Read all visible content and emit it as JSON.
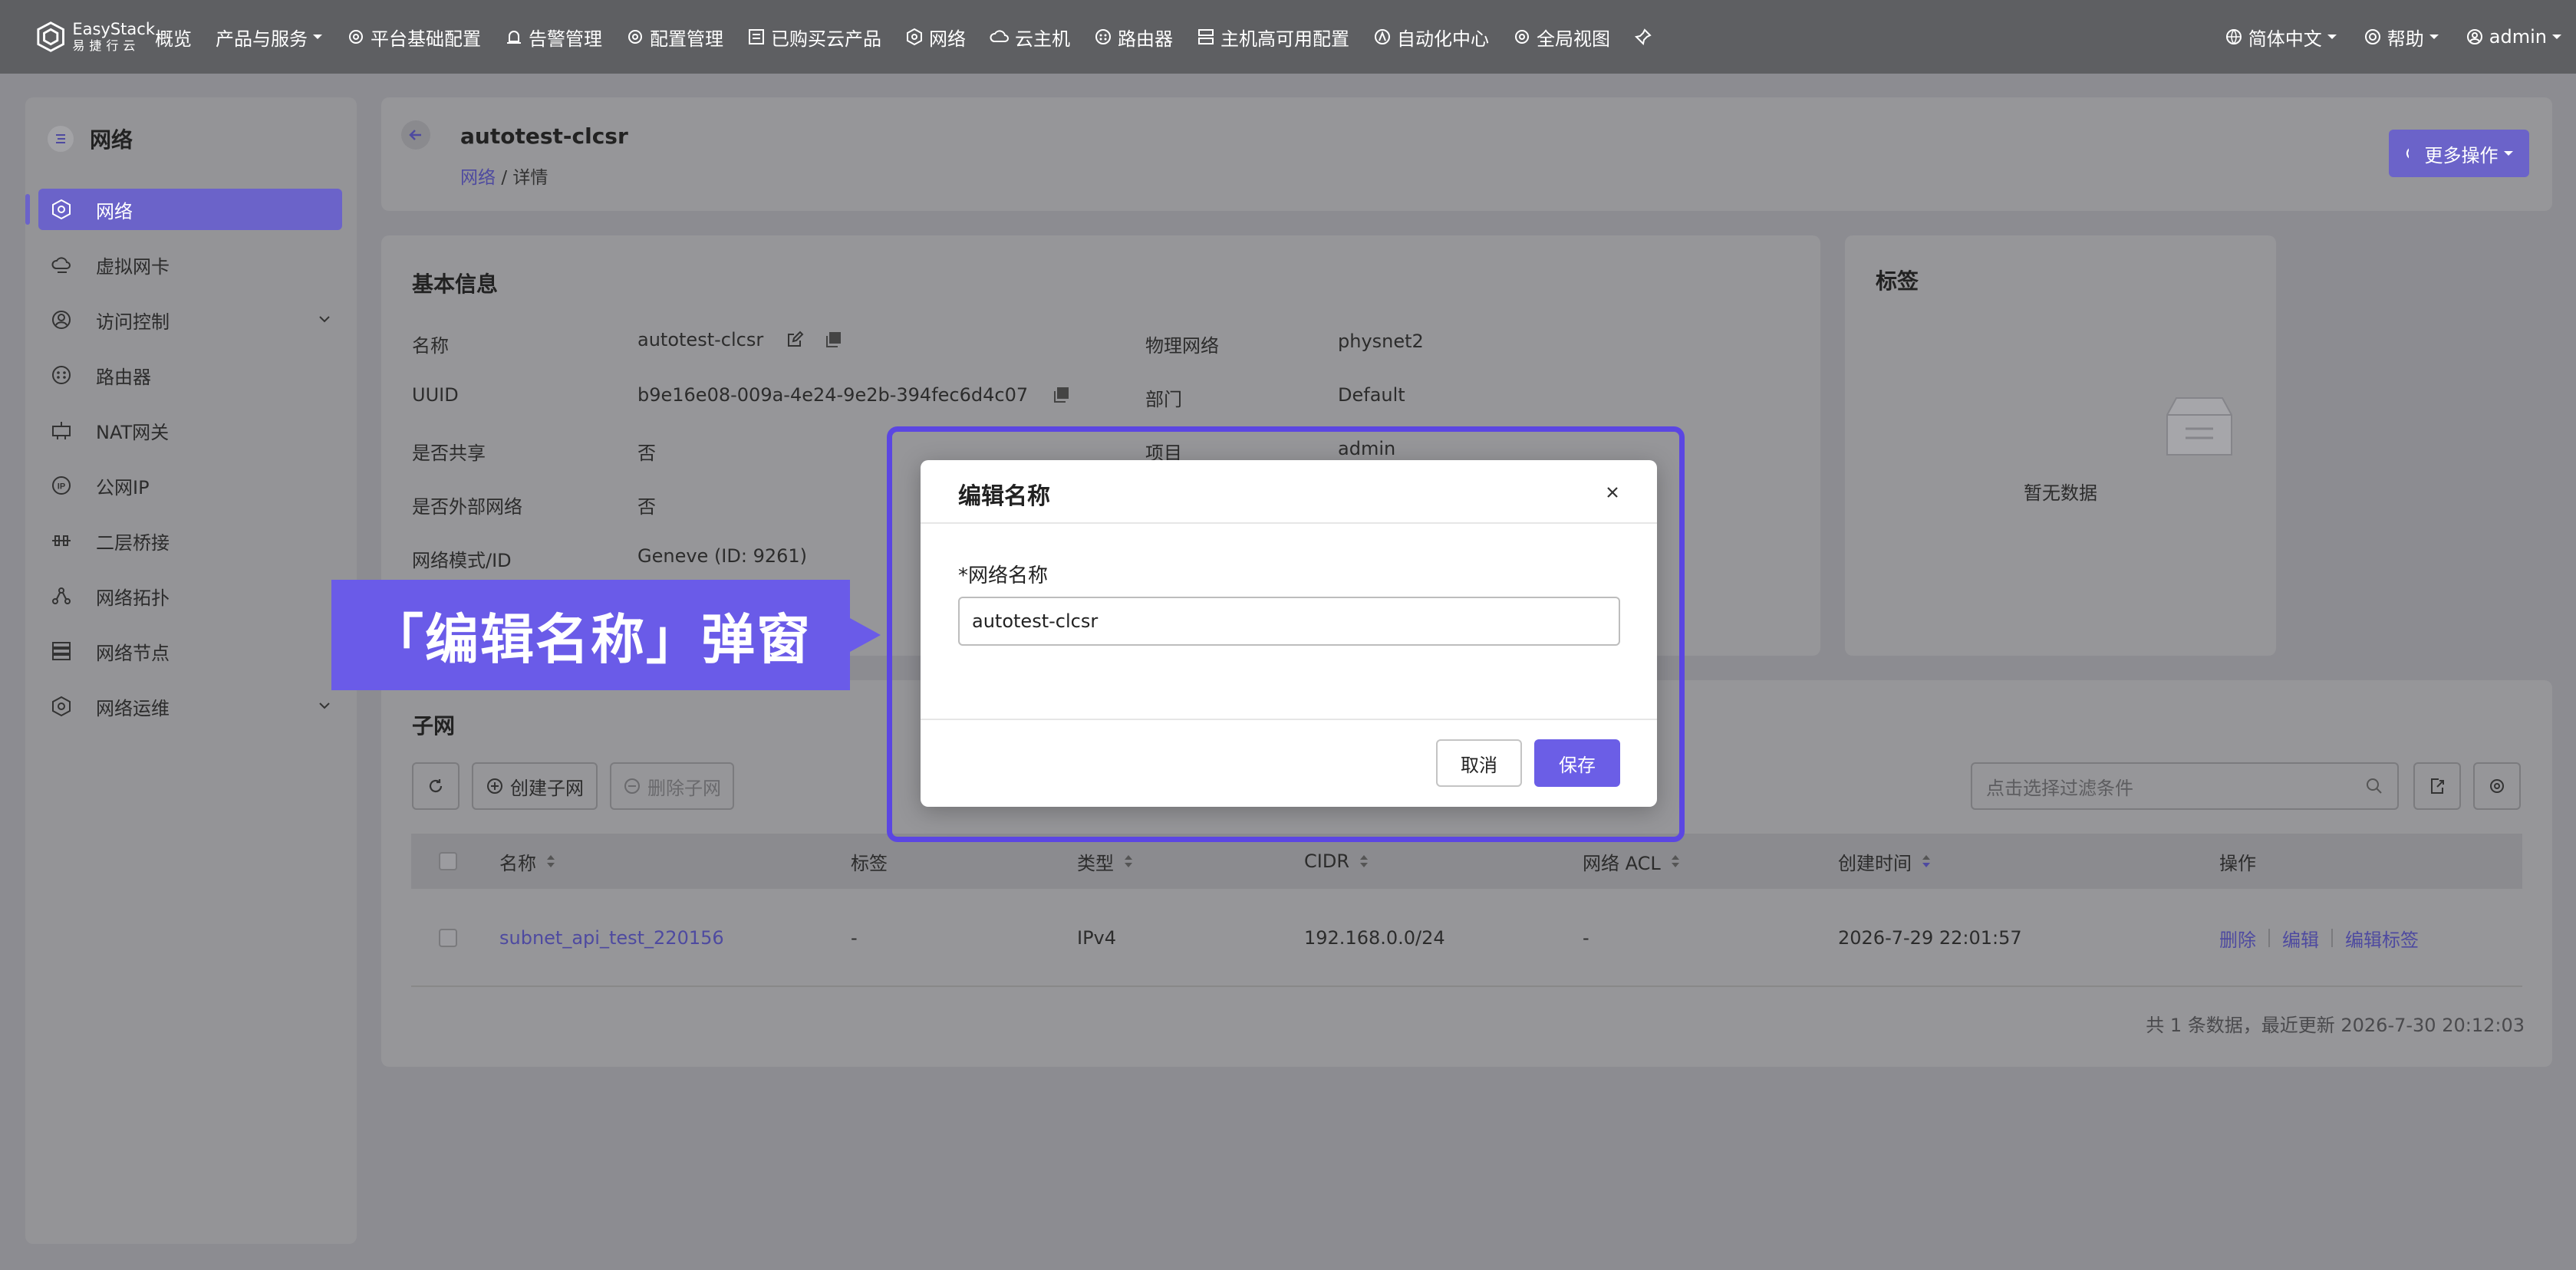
{
  "topbar": {
    "logo_en": "EasyStack",
    "logo_cn": "易捷行云",
    "nav": [
      {
        "label": "概览",
        "icon": ""
      },
      {
        "label": "产品与服务",
        "icon": "",
        "dropdown": true
      },
      {
        "label": "平台基础配置",
        "icon": "gear-icon"
      },
      {
        "label": "告警管理",
        "icon": "alarm-icon"
      },
      {
        "label": "配置管理",
        "icon": "gear-icon"
      },
      {
        "label": "已购买云产品",
        "icon": "list-icon"
      },
      {
        "label": "网络",
        "icon": "network-icon"
      },
      {
        "label": "云主机",
        "icon": "cloud-icon"
      },
      {
        "label": "路由器",
        "icon": "router-icon"
      },
      {
        "label": "主机高可用配置",
        "icon": "server-icon"
      },
      {
        "label": "自动化中心",
        "icon": "auto-icon"
      },
      {
        "label": "全局视图",
        "icon": "gear-icon"
      }
    ],
    "language": "简体中文",
    "help": "帮助",
    "user": "admin"
  },
  "sidebar": {
    "title": "网络",
    "items": [
      {
        "label": "网络",
        "icon": "network-icon",
        "active": true
      },
      {
        "label": "虚拟网卡",
        "icon": "vnic-icon"
      },
      {
        "label": "访问控制",
        "icon": "access-control-icon",
        "expandable": true
      },
      {
        "label": "路由器",
        "icon": "router-icon"
      },
      {
        "label": "NAT网关",
        "icon": "nat-gateway-icon"
      },
      {
        "label": "公网IP",
        "icon": "public-ip-icon"
      },
      {
        "label": "二层桥接",
        "icon": "bridge-icon"
      },
      {
        "label": "网络拓扑",
        "icon": "topology-icon"
      },
      {
        "label": "网络节点",
        "icon": "network-node-icon"
      },
      {
        "label": "网络运维",
        "icon": "network-ops-icon",
        "expandable": true
      }
    ]
  },
  "header": {
    "title": "autotest-clcsr",
    "breadcrumb_link": "网络",
    "breadcrumb_sep": "/",
    "breadcrumb_current": "详情",
    "more_actions": "更多操作"
  },
  "basic_info": {
    "title": "基本信息",
    "rows": [
      {
        "label": "名称",
        "value": "autotest-clcsr"
      },
      {
        "label": "UUID",
        "value": "b9e16e08-009a-4e24-9e2b-394fec6d4c07"
      },
      {
        "label": "是否共享",
        "value": "否"
      },
      {
        "label": "是否外部网络",
        "value": "否"
      },
      {
        "label": "网络模式/ID",
        "value": "Geneve (ID: 9261)"
      }
    ],
    "right_rows": [
      {
        "label": "物理网络",
        "value": "physnet2"
      },
      {
        "label": "部门",
        "value": "Default"
      },
      {
        "label": "项目",
        "value": "admin"
      }
    ]
  },
  "tags": {
    "title": "标签",
    "empty_text": "暂无数据"
  },
  "subnet": {
    "title": "子网",
    "create_label": "创建子网",
    "delete_label": "删除子网",
    "filter_placeholder": "点击选择过滤条件",
    "columns": [
      "名称",
      "标签",
      "类型",
      "CIDR",
      "网络 ACL",
      "创建时间",
      "操作"
    ],
    "rows": [
      {
        "name": "subnet_api_test_220156",
        "tag": "-",
        "type": "IPv4",
        "cidr": "192.168.0.0/24",
        "acl": "-",
        "created": "2026-7-29 22:01:57",
        "actions": [
          "删除",
          "编辑",
          "编辑标签"
        ]
      }
    ],
    "footer": "共 1 条数据，最近更新  2026-7-30 20:12:03"
  },
  "modal": {
    "title": "编辑名称",
    "field_label": "*网络名称",
    "field_value": "autotest-clcsr",
    "cancel": "取消",
    "save": "保存"
  },
  "callout": {
    "text": "「编辑名称」弹窗"
  },
  "colors": {
    "accent": "#6b63c9",
    "callout": "#6a5be8",
    "highlight_border": "#5b46e2",
    "topbar": "#5e5f62"
  }
}
